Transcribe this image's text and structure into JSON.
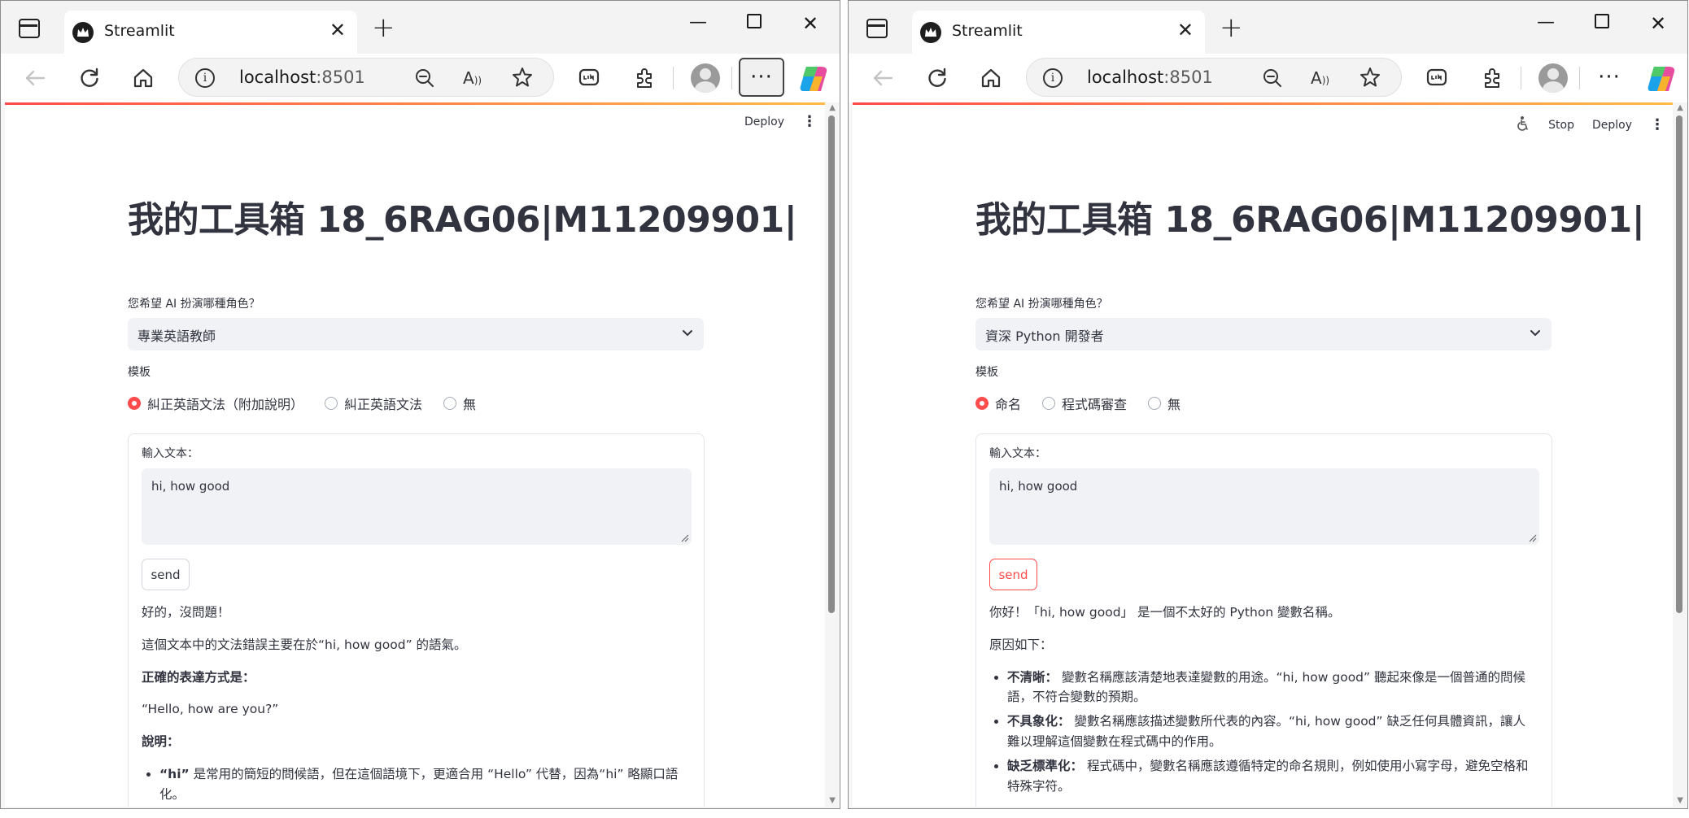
{
  "browser": {
    "tab_title": "Streamlit",
    "url_host": "localhost",
    "url_port": ":8501"
  },
  "left": {
    "header": {
      "deploy": "Deploy"
    },
    "title": "我的工具箱 18_6RAG06|M11209901|",
    "role_label": "您希望 AI 扮演哪種角色？",
    "role_value": "專業英語教師",
    "template_label": "模板",
    "template_options": [
      "糾正英語文法（附加說明）",
      "糾正英語文法",
      "無"
    ],
    "template_selected": 0,
    "input_label": "輸入文本：",
    "input_value": "hi, how good",
    "send_label": "send",
    "response": {
      "p1": "好的，沒問題！",
      "p2": "這個文本中的文法錯誤主要在於“hi, how good” 的語氣。",
      "p3": "正確的表達方式是：",
      "p4": "“Hello, how are you?”",
      "p5": "說明：",
      "li1_bold": "“hi”",
      "li1_text": " 是常用的簡短的問候語，但在這個語境下，更適合用 “Hello” 代替，因為“hi” 略顯口語化。"
    }
  },
  "right": {
    "header": {
      "stop": "Stop",
      "deploy": "Deploy"
    },
    "title": "我的工具箱 18_6RAG06|M11209901|",
    "role_label": "您希望 AI 扮演哪種角色？",
    "role_value": "資深 Python 開發者",
    "template_label": "模板",
    "template_options": [
      "命名",
      "程式碼審查",
      "無"
    ],
    "template_selected": 0,
    "input_label": "輸入文本：",
    "input_value": "hi, how good",
    "send_label": "send",
    "response": {
      "p1": "你好！「hi, how good」 是一個不太好的 Python 變數名稱。",
      "p2": "原因如下：",
      "li1_bold": "不清晰：",
      "li1_text": " 變數名稱應該清楚地表達變數的用途。“hi, how good” 聽起來像是一個普通的問候語，不符合變數的預期。",
      "li2_bold": "不具象化：",
      "li2_text": " 變數名稱應該描述變數所代表的內容。“hi, how good” 缺乏任何具體資訊，讓人難以理解這個變數在程式碼中的作用。",
      "li3_bold": "缺乏標準化：",
      "li3_text": " 程式碼中，變數名稱應該遵循特定的命名規則，例如使用小寫字母，避免空格和特殊字符。"
    }
  },
  "colors": {
    "accent": "#ff4b4b",
    "text": "#31333f",
    "widget_bg": "#f0f2f6"
  },
  "icons": [
    "sidebar-toggle-icon",
    "streamlit-crown-icon",
    "close-icon",
    "plus-icon",
    "minimize-icon",
    "maximize-icon",
    "back-icon",
    "refresh-icon",
    "home-icon",
    "info-icon",
    "zoom-out-icon",
    "read-aloud-icon",
    "favorite-star-icon",
    "line-app-icon",
    "extensions-icon",
    "profile-avatar-icon",
    "more-icon",
    "copilot-icon",
    "accessibility-icon",
    "kebab-icon",
    "chevron-down-icon"
  ]
}
